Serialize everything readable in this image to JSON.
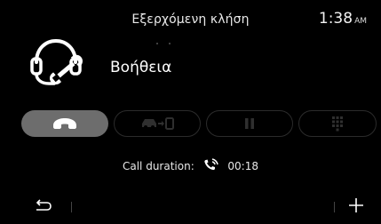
{
  "header": {
    "title": "Εξερχόμενη κλήση",
    "time": "1:38",
    "ampm": "AM"
  },
  "contact": {
    "name": "Βοήθεια",
    "icon": "support-headset-wrench-icon"
  },
  "controls": [
    {
      "name": "end-call-button",
      "icon": "hang-up-icon",
      "active": true
    },
    {
      "name": "transfer-to-phone-button",
      "icon": "car-to-phone-icon",
      "active": false
    },
    {
      "name": "pause-button",
      "icon": "pause-icon",
      "active": false
    },
    {
      "name": "keypad-button",
      "icon": "dialpad-icon",
      "active": false
    }
  ],
  "call": {
    "duration_label": "Call duration:",
    "duration_value": "00:18",
    "icon": "outgoing-call-icon"
  },
  "footer": {
    "back_icon": "back-arrow-icon",
    "add_icon": "plus-icon"
  },
  "colors": {
    "background": "#000000",
    "end_button_fill": "#6d6d6d",
    "outline_button_border": "#2b2b2b",
    "inactive_icon": "#2f2f2f"
  }
}
